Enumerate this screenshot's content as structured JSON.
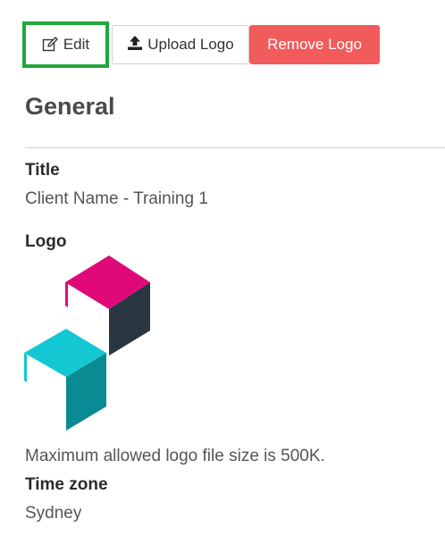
{
  "toolbar": {
    "edit_label": "Edit",
    "upload_label": "Upload Logo",
    "remove_label": "Remove Logo"
  },
  "section": {
    "title": "General"
  },
  "fields": {
    "title_label": "Title",
    "title_value": "Client Name - Training 1",
    "logo_label": "Logo",
    "logo_note": "Maximum allowed logo file size is 500K.",
    "timezone_label": "Time zone",
    "timezone_value": "Sydney"
  },
  "icons": {
    "edit": "edit-icon",
    "upload": "upload-icon"
  },
  "colors": {
    "edit_highlight": "#1fa83c",
    "remove_button": "#f15b5b",
    "logo_magenta": "#e0097a",
    "logo_dark": "#2a3640",
    "logo_cyan": "#13c8d2",
    "logo_teal": "#0a8a92"
  }
}
